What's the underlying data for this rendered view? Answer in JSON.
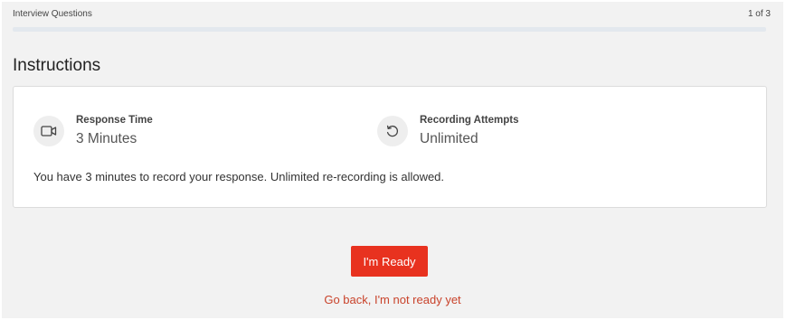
{
  "header": {
    "title": "Interview Questions",
    "counter": "1 of 3",
    "progress_fraction": 0
  },
  "section_title": "Instructions",
  "instructions": {
    "items": [
      {
        "label": "Response Time",
        "value": "3 Minutes",
        "icon": "video-camera-icon"
      },
      {
        "label": "Recording Attempts",
        "value": "Unlimited",
        "icon": "retry-icon"
      }
    ],
    "description": "You have 3 minutes to record your response. Unlimited re-recording is allowed."
  },
  "actions": {
    "ready_label": "I'm Ready",
    "back_label": "Go back, I'm not ready yet"
  },
  "colors": {
    "primary": "#e8321f",
    "link": "#c9432b",
    "background": "#f2f2f2"
  }
}
